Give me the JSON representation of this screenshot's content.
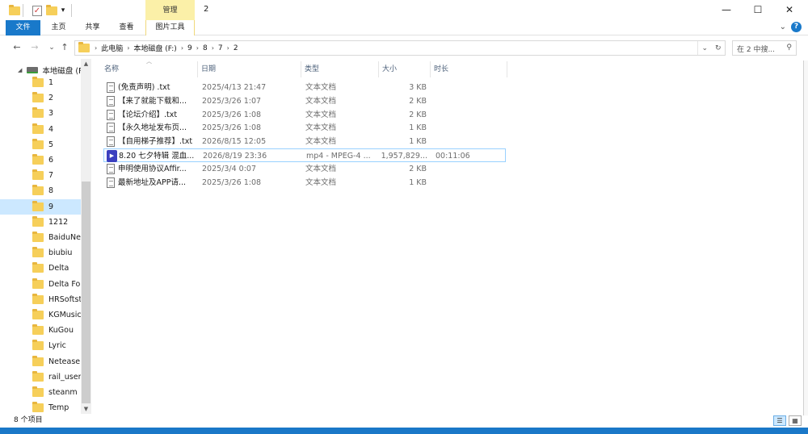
{
  "window": {
    "title": "2",
    "context_tab": "管理",
    "controls": {
      "minimize": "—",
      "maximize": "☐",
      "close": "✕"
    }
  },
  "ribbon": {
    "tabs": [
      "文件",
      "主页",
      "共享",
      "查看",
      "图片工具"
    ],
    "expand_glyph": "⌄",
    "help": "?"
  },
  "nav": {
    "back": "←",
    "forward": "→",
    "recent": "⌄",
    "up": "↑",
    "breadcrumbs": [
      "此电脑",
      "本地磁盘 (F:)",
      "9",
      "8",
      "7",
      "2"
    ],
    "dropdown": "⌄",
    "refresh": "↻",
    "search_placeholder": "在 2 中搜...",
    "search_icon": "⚲"
  },
  "navpane": {
    "drive": "本地磁盘 (F",
    "folders": [
      "1",
      "2",
      "3",
      "4",
      "5",
      "6",
      "7",
      "8",
      "9",
      "1212",
      "BaiduNet",
      "biubiu",
      "Delta",
      "Delta Fore",
      "HRSoftsto",
      "KGMusic",
      "KuGou",
      "Lyric",
      "Netease",
      "rail_user_",
      "steanm",
      "Temp"
    ],
    "selected": "9"
  },
  "columns": {
    "name": "名称",
    "date": "日期",
    "type": "类型",
    "size": "大小",
    "duration": "时长"
  },
  "files": [
    {
      "name": "(免责声明) .txt",
      "date": "2025/4/13 21:47",
      "type": "文本文档",
      "size": "3 KB",
      "duration": "",
      "icon": "txt"
    },
    {
      "name": "【来了就能下载和...",
      "date": "2025/3/26 1:07",
      "type": "文本文档",
      "size": "2 KB",
      "duration": "",
      "icon": "txt"
    },
    {
      "name": "【论坛介绍】.txt",
      "date": "2025/3/26 1:08",
      "type": "文本文档",
      "size": "2 KB",
      "duration": "",
      "icon": "txt"
    },
    {
      "name": "【永久地址发布页...",
      "date": "2025/3/26 1:08",
      "type": "文本文档",
      "size": "1 KB",
      "duration": "",
      "icon": "txt"
    },
    {
      "name": "【自用梯子推荐】.txt",
      "date": "2026/8/15 12:05",
      "type": "文本文档",
      "size": "1 KB",
      "duration": "",
      "icon": "txt"
    },
    {
      "name": "8.20 七夕特辑 混血...",
      "date": "2026/8/19 23:36",
      "type": "mp4 - MPEG-4 ...",
      "size": "1,957,829...",
      "duration": "00:11:06",
      "icon": "mp4"
    },
    {
      "name": "申明使用协议Affir...",
      "date": "2025/3/4 0:07",
      "type": "文本文档",
      "size": "2 KB",
      "duration": "",
      "icon": "txt"
    },
    {
      "name": "最新地址及APP请...",
      "date": "2025/3/26 1:08",
      "type": "文本文档",
      "size": "1 KB",
      "duration": "",
      "icon": "txt"
    }
  ],
  "selected_file": 5,
  "status": {
    "count": "8 个项目"
  }
}
